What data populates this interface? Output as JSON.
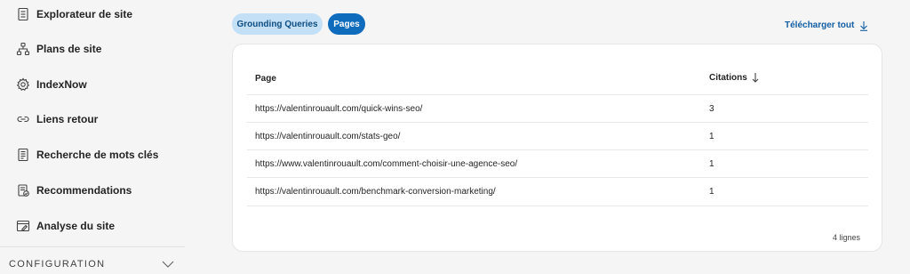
{
  "sidebar": {
    "items": [
      {
        "label": "Explorateur de site",
        "icon": "document-icon"
      },
      {
        "label": "Plans de site",
        "icon": "sitemap-icon"
      },
      {
        "label": "IndexNow",
        "icon": "gear-icon"
      },
      {
        "label": "Liens retour",
        "icon": "link-icon"
      },
      {
        "label": "Recherche de mots clés",
        "icon": "document-list-icon"
      },
      {
        "label": "Recommendations",
        "icon": "clipboard-check-icon"
      },
      {
        "label": "Analyse du site",
        "icon": "window-edit-icon"
      }
    ],
    "section": {
      "label": "CONFIGURATION",
      "icon": "chevron-down-icon"
    }
  },
  "tabs": [
    {
      "label": "Grounding Queries",
      "selected": false
    },
    {
      "label": "Pages",
      "selected": true
    }
  ],
  "download": {
    "label": "Télécharger tout",
    "icon": "arrow-down-icon"
  },
  "table": {
    "columns": {
      "page": "Page",
      "citations": "Citations",
      "sort_icon": "arrow-down-icon"
    },
    "rows": [
      {
        "page": "https://valentinrouault.com/quick-wins-seo/",
        "citations": "3"
      },
      {
        "page": "https://valentinrouault.com/stats-geo/",
        "citations": "1"
      },
      {
        "page": "https://www.valentinrouault.com/comment-choisir-une-agence-seo/",
        "citations": "1"
      },
      {
        "page": "https://valentinrouault.com/benchmark-conversion-marketing/",
        "citations": "1"
      }
    ],
    "footer": "4 lignes"
  },
  "colors": {
    "accent": "#0f6cbd",
    "pill_light": "#c3e0f7",
    "link": "#115ea3",
    "background": "#f5f5f5",
    "card": "#ffffff"
  }
}
